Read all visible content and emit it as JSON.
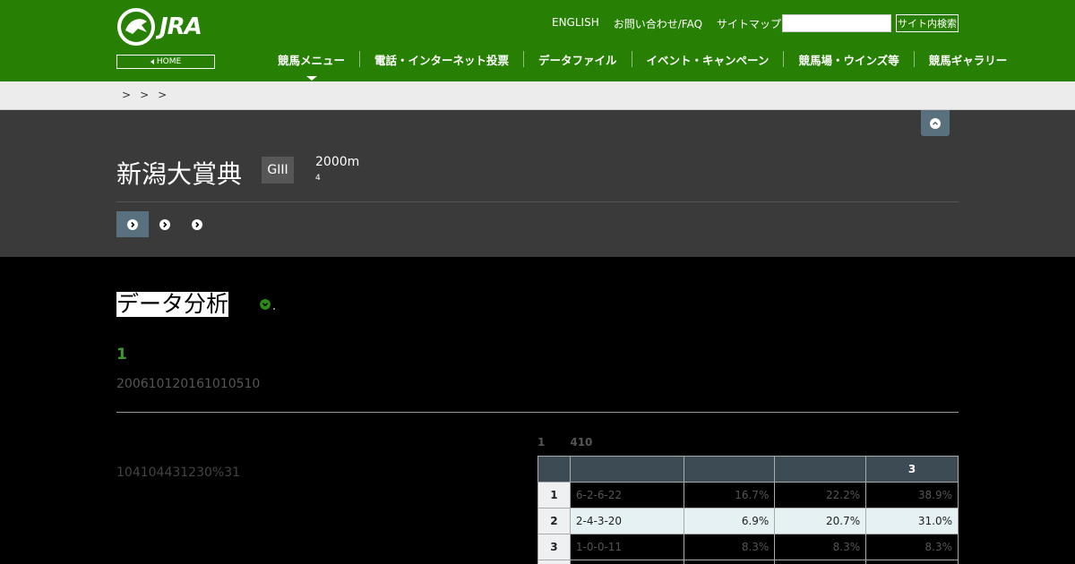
{
  "header": {
    "logo_text": "JRA",
    "home_label": "HOME",
    "util_links": [
      "ENGLISH",
      "お問い合わせ/FAQ",
      "サイトマップ"
    ],
    "search_placeholder": "",
    "search_button": "サイト内検索",
    "nav": [
      "競馬メニュー",
      "電話・インターネット投票",
      "データファイル",
      "イベント・キャンペーン",
      "競馬場・ウインズ等",
      "競馬ギャラリー"
    ],
    "active_nav": 0
  },
  "breadcrumb": [
    ">",
    ">",
    ">"
  ],
  "race": {
    "title": "新潟大賞典",
    "grade": "GIII",
    "distance": "2000m",
    "distance_sub": "4",
    "tabs": 3
  },
  "main": {
    "section_title": "データ分析",
    "sub_heading": "1",
    "desc": "200610120161010510",
    "left_text": "104104431230%31",
    "table_caption": [
      "1",
      "410"
    ],
    "table": {
      "headers": [
        "",
        "",
        "",
        "",
        "3"
      ],
      "rows": [
        {
          "rank": "1",
          "record": "6-2-6-22",
          "c1": "16.7%",
          "c2": "22.2%",
          "c3": "38.9%",
          "style": "dark"
        },
        {
          "rank": "2",
          "record": "2-4-3-20",
          "c1": "6.9%",
          "c2": "20.7%",
          "c3": "31.0%",
          "style": "hl"
        },
        {
          "rank": "3",
          "record": "1-0-0-11",
          "c1": "8.3%",
          "c2": "8.3%",
          "c3": "8.3%",
          "style": "dark"
        }
      ]
    }
  },
  "colors": {
    "header_green": "#278004",
    "race_bg": "#3a3a3a",
    "accent_green": "#3c9a2b",
    "table_header": "#3d4b54",
    "tab_active": "#59707e"
  }
}
